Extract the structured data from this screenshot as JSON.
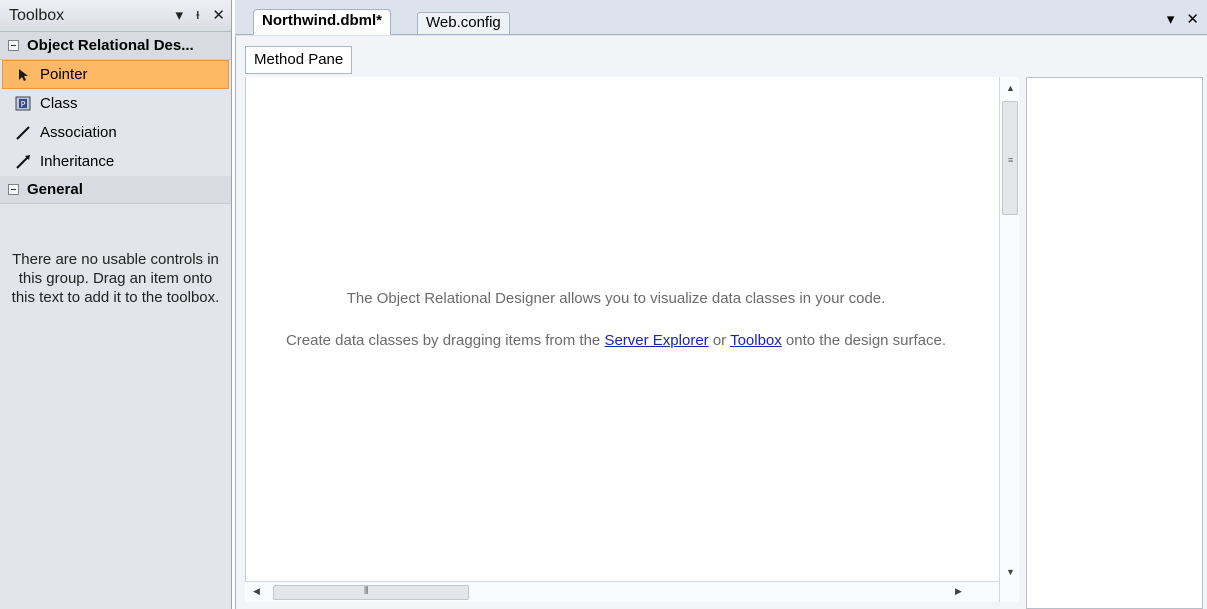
{
  "toolbox": {
    "title": "Toolbox",
    "controls": {
      "dropdown": "▾",
      "pin": "ᵻ",
      "close": "✕"
    },
    "groups": [
      {
        "label": "Object Relational Des...",
        "items": [
          {
            "label": "Pointer",
            "icon": "pointer-icon",
            "selected": true
          },
          {
            "label": "Class",
            "icon": "class-icon"
          },
          {
            "label": "Association",
            "icon": "association-icon"
          },
          {
            "label": "Inheritance",
            "icon": "inheritance-icon"
          }
        ]
      },
      {
        "label": "General",
        "empty_message": "There are no usable controls in this group. Drag an item onto this text to add it to the toolbox."
      }
    ]
  },
  "document": {
    "tabs": [
      {
        "label": "Northwind.dbml*",
        "active": true
      },
      {
        "label": "Web.config",
        "active": false
      }
    ],
    "controls": {
      "dropdown": "▾",
      "close": "✕"
    },
    "method_pane_label": "Method Pane",
    "designer": {
      "message_1": "The Object Relational Designer allows you to visualize data classes in your code.",
      "message_2_before": "Create data classes by dragging items from the ",
      "link_server_explorer": "Server Explorer",
      "message_2_or": " or ",
      "link_toolbox": "Toolbox",
      "message_2_after": " onto the design surface."
    },
    "accent_colors": {
      "selected_item": "#fcb864",
      "link": "#1a23b8"
    }
  }
}
